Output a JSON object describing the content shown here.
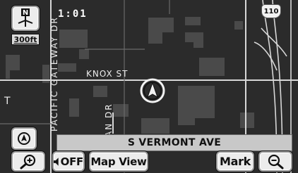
{
  "status": {
    "time": "1:01",
    "scale": "300ft"
  },
  "map": {
    "route_shield": "110",
    "streets": {
      "pacific_gateway": "PACIFIC GATEWAY DR",
      "knox": "KNOX ST",
      "an_dr": "AN DR",
      "edge_fragment": "T"
    },
    "current_street": "S VERMONT AVE"
  },
  "toolbar": {
    "voice_toggle_label": "OFF",
    "map_view_label": "Map View",
    "mark_label": "Mark"
  },
  "icons": {
    "north": "north-up-icon",
    "compass": "compass-icon",
    "zoom_in": "zoom-in-icon",
    "zoom_out": "zoom-out-icon",
    "voice_off": "speaker-off-icon",
    "marker": "vehicle-position-icon"
  },
  "colors": {
    "map_bg": "#2b2b2b",
    "roads": "#d7d7d7",
    "buttons": "#ececec"
  }
}
